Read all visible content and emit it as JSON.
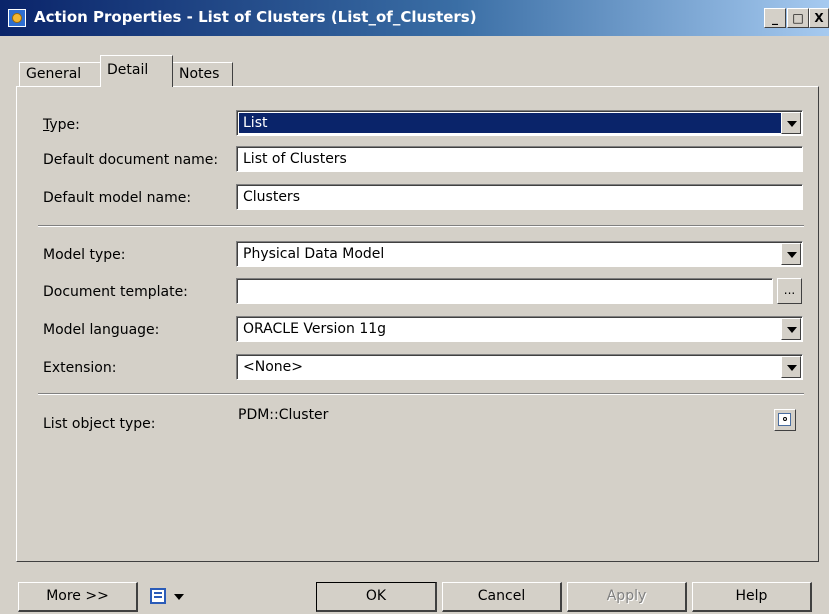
{
  "window": {
    "title": "Action Properties - List of Clusters (List_of_Clusters)",
    "min_glyph": "_",
    "max_glyph": "□",
    "close_glyph": "X"
  },
  "tabs": [
    {
      "label": "General",
      "active": false
    },
    {
      "label": "Detail",
      "active": true
    },
    {
      "label": "Notes",
      "active": false
    }
  ],
  "form": {
    "type": {
      "label": "Type:",
      "value": "List"
    },
    "doc_name": {
      "label": "Default document name:",
      "value": "List of Clusters"
    },
    "model_name": {
      "label": "Default model name:",
      "value": "Clusters"
    },
    "model_type": {
      "label": "Model type:",
      "value": "Physical Data Model"
    },
    "doc_template": {
      "label": "Document template:",
      "value": "",
      "browse": "..."
    },
    "model_language": {
      "label": "Model language:",
      "value": "ORACLE Version 11g"
    },
    "extension": {
      "label": "Extension:",
      "value": "<None>"
    },
    "list_object_type": {
      "label": "List object type:",
      "value": "PDM::Cluster"
    }
  },
  "buttons": {
    "more": "More >>",
    "ok": "OK",
    "cancel": "Cancel",
    "apply": "Apply",
    "help": "Help"
  },
  "colors": {
    "face": "#d4d0c8",
    "title_start": "#0a246a",
    "title_end": "#a6caf0",
    "selection": "#0a246a"
  }
}
